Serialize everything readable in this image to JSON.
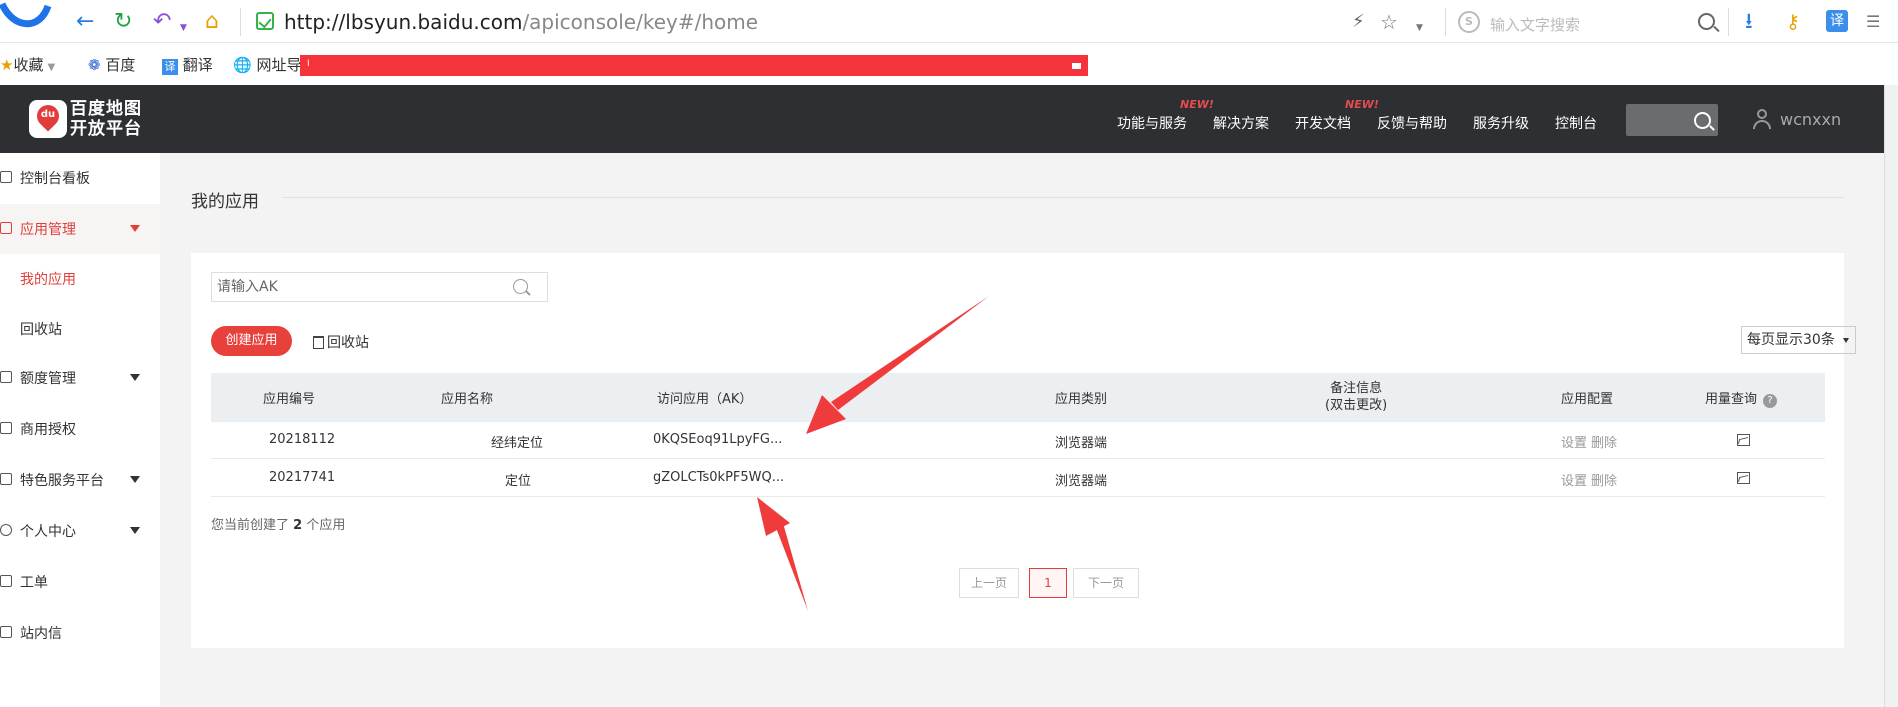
{
  "browser": {
    "url_host": "http://lbsyun.baidu.com",
    "url_path": "/apiconsole/key#/home",
    "search_placeholder": "输入文字搜索",
    "search_engine_letter": "S",
    "translate_badge": "译",
    "bookmarks": [
      {
        "icon": "star-icon",
        "label": "收藏"
      },
      {
        "icon": "baidu-paw-icon",
        "label": "百度"
      },
      {
        "icon": "translate-icon",
        "label": "翻译"
      },
      {
        "icon": "globe-icon",
        "label": "网址导"
      }
    ],
    "bookmark_overflow_char": "I"
  },
  "header": {
    "brand_line1": "百度地图",
    "brand_line2": "开放平台",
    "brand_badge": "du",
    "nav": [
      {
        "label": "功能与服务",
        "badge": ""
      },
      {
        "label": "解决方案",
        "badge": "NEW!"
      },
      {
        "label": "开发文档",
        "badge": ""
      },
      {
        "label": "反馈与帮助",
        "badge": "NEW!"
      },
      {
        "label": "服务升级",
        "badge": ""
      },
      {
        "label": "控制台",
        "badge": ""
      }
    ],
    "username": "wcnxxn"
  },
  "sidebar": {
    "items": [
      {
        "label": "控制台看板",
        "icon": "dashboard-icon",
        "has_caret": false,
        "active": false
      },
      {
        "label": "应用管理",
        "icon": "apps-icon",
        "has_caret": true,
        "active": true
      },
      {
        "label": "额度管理",
        "icon": "quota-icon",
        "has_caret": true,
        "active": false
      },
      {
        "label": "商用授权",
        "icon": "shield-icon",
        "has_caret": false,
        "active": false
      },
      {
        "label": "特色服务平台",
        "icon": "service-icon",
        "has_caret": true,
        "active": false
      },
      {
        "label": "个人中心",
        "icon": "user-icon",
        "has_caret": true,
        "active": false
      },
      {
        "label": "工单",
        "icon": "ticket-icon",
        "has_caret": false,
        "active": false
      },
      {
        "label": "站内信",
        "icon": "message-icon",
        "has_caret": false,
        "active": false
      }
    ],
    "sub_items": [
      {
        "label": "我的应用",
        "current": true
      },
      {
        "label": "回收站",
        "current": false
      }
    ]
  },
  "main": {
    "title": "我的应用",
    "ak_placeholder": "请输入AK",
    "create_label": "创建应用",
    "recycle_label": "回收站",
    "page_size_label": "每页显示30条",
    "columns": {
      "id": "应用编号",
      "name": "应用名称",
      "ak": "访问应用（AK）",
      "type": "应用类别",
      "note_line1": "备注信息",
      "note_line2": "(双击更改)",
      "config": "应用配置",
      "usage": "用量查询",
      "usage_help": "?"
    },
    "rows": [
      {
        "id": "20218112",
        "name": "经纬定位",
        "ak": "0KQSEoq91LpyFG...",
        "type": "浏览器端",
        "note": "",
        "config_set": "设置",
        "config_delete": "删除"
      },
      {
        "id": "20217741",
        "name": "定位",
        "ak": "gZOLCTs0kPF5WQ...",
        "type": "浏览器端",
        "note": "",
        "config_set": "设置",
        "config_delete": "删除"
      }
    ],
    "summary_prefix": "您当前创建了",
    "summary_count": "2",
    "summary_suffix": "个应用",
    "pager": {
      "prev": "上一页",
      "current": "1",
      "next": "下一页"
    }
  },
  "colors": {
    "accent_red": "#e8403a",
    "header_dark": "#2d2f32",
    "annotation_arrow": "#ef3b3b"
  }
}
